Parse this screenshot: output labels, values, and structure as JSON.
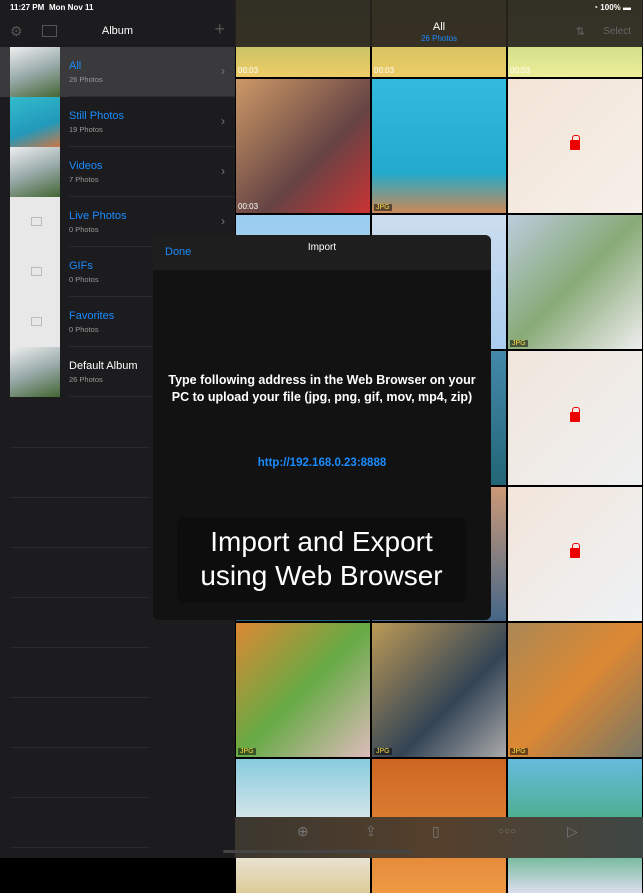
{
  "status": {
    "time": "11:27 PM",
    "date": "Mon Nov 11",
    "battery": "100%"
  },
  "sidebar": {
    "title": "Album",
    "icons": [
      "gear-icon",
      "folder-icon",
      "plus-icon"
    ],
    "albums": [
      {
        "name": "All",
        "count": "26 Photos",
        "selected": true
      },
      {
        "name": "Still Photos",
        "count": "19 Photos"
      },
      {
        "name": "Videos",
        "count": "7 Photos"
      },
      {
        "name": "Live Photos",
        "count": "0 Photos"
      },
      {
        "name": "GIFs",
        "count": "0 Photos"
      },
      {
        "name": "Favorites",
        "count": "0 Photos"
      },
      {
        "name": "Default Album",
        "count": "26 Photos"
      }
    ]
  },
  "header": {
    "title": "All",
    "subtitle": "26 Photos",
    "select": "Select"
  },
  "grid": {
    "labels": [
      [
        "00:03",
        "00:03",
        "00:03"
      ],
      [
        "00:03",
        "JPG",
        "lock"
      ],
      [
        "",
        "",
        "JPG"
      ],
      [
        "",
        "",
        "lock"
      ],
      [
        "",
        "",
        "lock"
      ],
      [
        "JPG",
        "JPG",
        "JPG"
      ],
      [
        "",
        "",
        ""
      ]
    ]
  },
  "modal": {
    "done": "Done",
    "title": "Import",
    "message": "Type following address in the Web Browser on your PC to upload your file (jpg, png, gif, mov, mp4, zip)",
    "url": "http://192.168.0.23:8888"
  },
  "banner": {
    "line1": "Import and Export",
    "line2": "using Web Browser"
  },
  "toolbar": {
    "icons": [
      "add-icon",
      "share-icon",
      "trash-icon",
      "more-icon",
      "play-icon"
    ]
  },
  "colors": {
    "accent": "#1a8cff",
    "lock": "#e00000"
  }
}
